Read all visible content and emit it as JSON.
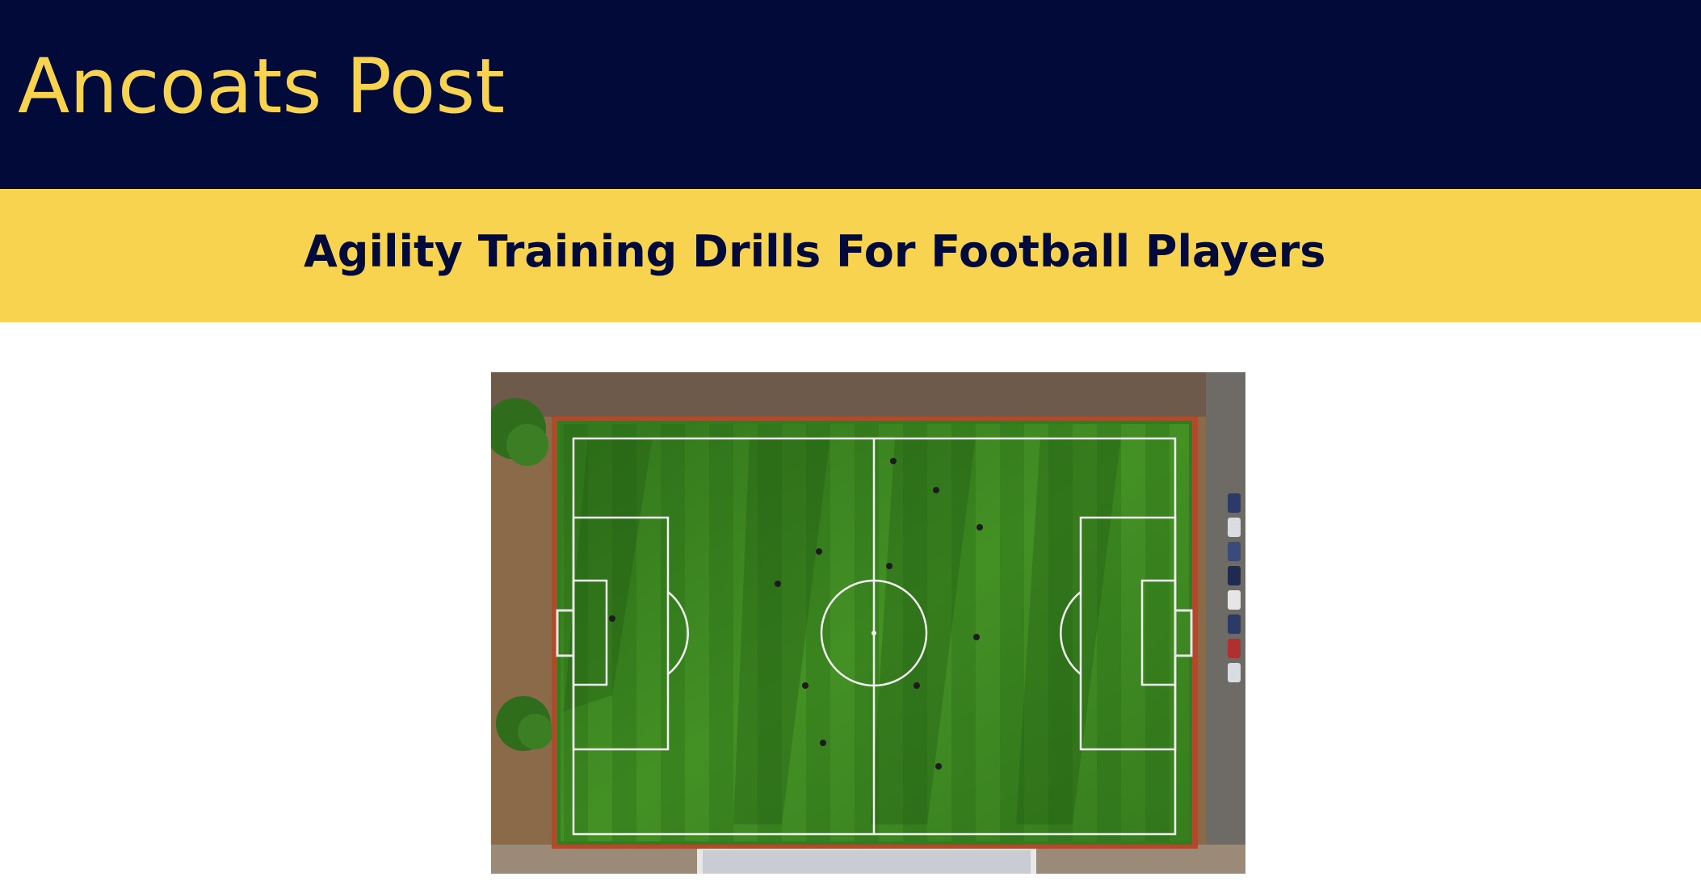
{
  "site": {
    "title": "Ancoats Post"
  },
  "article": {
    "headline": "Agility Training Drills For Football Players",
    "hero_image": {
      "subject": "aerial-football-pitch"
    }
  },
  "colors": {
    "masthead_bg": "#010a38",
    "accent": "#f7d350",
    "pitch_green": "#3f8f22",
    "page_bg": "#ffffff"
  }
}
